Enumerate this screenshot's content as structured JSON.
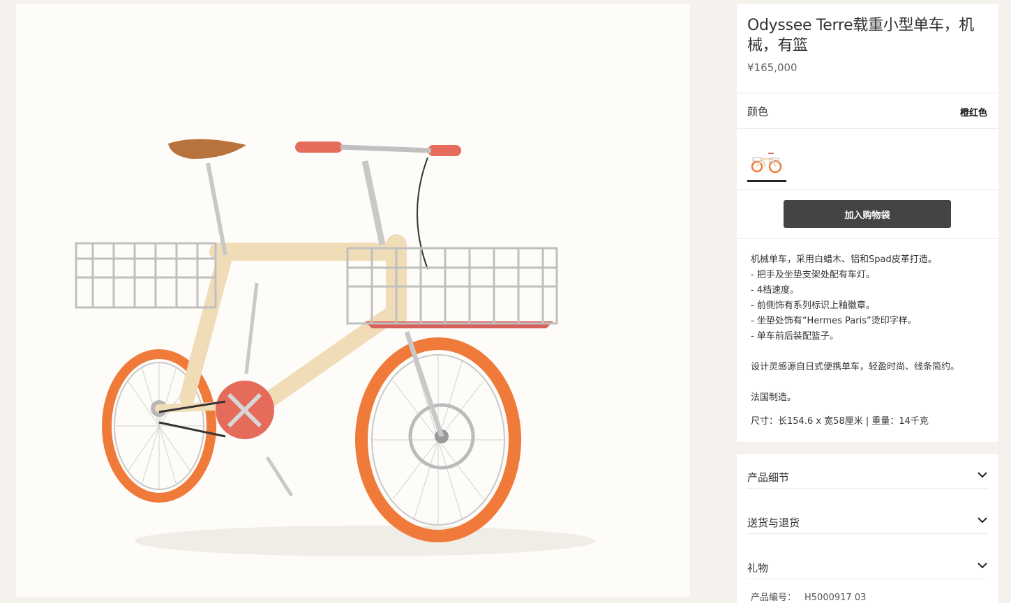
{
  "product": {
    "title": "Odyssee Terre载重小型单车，机械，有篮",
    "price": "¥165,000",
    "color_label": "颜色",
    "color_value": "橙红色",
    "add_to_bag": "加入购物袋",
    "description": [
      "机械单车，采用白蜡木、铝和Spad皮革打造。",
      "- 把手及坐垫支架处配有车灯。",
      "- 4档速度。",
      "- 前侧饰有系列标识上釉徽章。",
      "- 坐垫处饰有“Hermes Paris”烫印字样。",
      "- 单车前后装配篮子。",
      "",
      "设计灵感源自日式便携单车，轻盈时尚、线条简约。",
      "",
      "法国制造。"
    ],
    "dimensions": "尺寸：长154.6 x 宽58厘米 | 重量：14千克"
  },
  "accordions": [
    {
      "label": "产品细节",
      "icon": "chevron-down-icon"
    },
    {
      "label": "送货与退货",
      "icon": "chevron-down-icon"
    },
    {
      "label": "礼物",
      "icon": "chevron-down-icon"
    }
  ],
  "sku": {
    "label": "产品编号：",
    "value": "H5000917 03"
  },
  "colors": {
    "background": "#f5f1ec",
    "button": "#444444",
    "tire": "#f07a3a",
    "frame": "#f1dcb8"
  }
}
